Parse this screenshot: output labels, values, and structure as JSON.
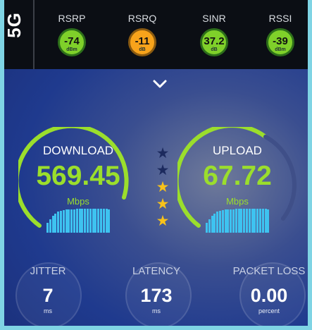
{
  "network_type": "5G",
  "signal": [
    {
      "name": "RSRP",
      "value": "-74",
      "unit": "dBm",
      "color": "green"
    },
    {
      "name": "RSRQ",
      "value": "-11",
      "unit": "dB",
      "color": "orange"
    },
    {
      "name": "SINR",
      "value": "37.2",
      "unit": "dB",
      "color": "green"
    },
    {
      "name": "RSSI",
      "value": "-39",
      "unit": "dBm",
      "color": "green"
    }
  ],
  "expand_icon": "chevron-down-icon",
  "download": {
    "label": "DOWNLOAD",
    "value": "569.45",
    "unit": "Mbps",
    "arc_fraction": 0.82
  },
  "upload": {
    "label": "UPLOAD",
    "value": "67.72",
    "unit": "Mbps",
    "arc_fraction": 0.62
  },
  "rating": {
    "filled": 3,
    "max": 5
  },
  "stats": {
    "jitter": {
      "label": "JITTER",
      "value": "7",
      "unit": "ms"
    },
    "latency": {
      "label": "LATENCY",
      "value": "173",
      "unit": "ms"
    },
    "packet_loss": {
      "label": "PACKET LOSS",
      "value": "0.00",
      "unit": "percent"
    }
  },
  "colors": {
    "accent_green": "#9bde2c",
    "accent_orange": "#f8a31b",
    "bar_blue": "#3ec3f0",
    "star_gold": "#f8c21a",
    "star_empty": "#1c2a5e"
  }
}
